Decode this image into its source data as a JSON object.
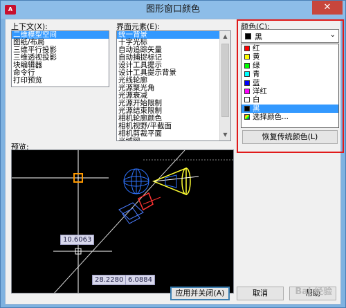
{
  "window": {
    "title": "图形窗口颜色",
    "app_icon": "A",
    "close_label": "✕"
  },
  "context": {
    "label": "上下文(X):",
    "items": [
      "二维模型空间",
      "图纸/布局",
      "三维平行投影",
      "三维透视投影",
      "块编辑器",
      "命令行",
      "打印预览"
    ],
    "selected_index": 0
  },
  "interface_elements": {
    "label": "界面元素(E):",
    "items": [
      "统一背景",
      "十字光标",
      "自动追踪矢量",
      "自动捕捉标记",
      "设计工具提示",
      "设计工具提示背景",
      "光线轮廓",
      "光源聚光角",
      "光源衰减",
      "光源开始限制",
      "光源结束限制",
      "相机轮廓颜色",
      "相机视野/平截面",
      "相机剪裁平面",
      "光域网"
    ],
    "selected_index": 0
  },
  "color": {
    "label": "颜色(C):",
    "selected": "黑",
    "selected_swatch": "#000000",
    "options": [
      {
        "label": "红",
        "swatch": "#ff0000"
      },
      {
        "label": "黄",
        "swatch": "#ffff00"
      },
      {
        "label": "绿",
        "swatch": "#00ff00"
      },
      {
        "label": "青",
        "swatch": "#00ffff"
      },
      {
        "label": "蓝",
        "swatch": "#0000ff"
      },
      {
        "label": "洋红",
        "swatch": "#ff00ff"
      },
      {
        "label": "白",
        "swatch": "#ffffff"
      },
      {
        "label": "黑",
        "swatch": "#000000"
      },
      {
        "label": "选择颜色...",
        "swatch": "multicolor"
      }
    ],
    "highlighted_index": 7,
    "restore_button": "恢复传统颜色(L)"
  },
  "preview": {
    "label": "预览:",
    "coord_1": "10.6063",
    "coord_2": "28.2280",
    "coord_3": "6.0884"
  },
  "buttons": {
    "apply_close": "应用并关闭(A)",
    "cancel": "取消",
    "help": "帮助"
  },
  "watermark": "Bai 经验",
  "colors": {
    "accent": "#3399ff",
    "highlight_frame": "#e01a1a"
  }
}
